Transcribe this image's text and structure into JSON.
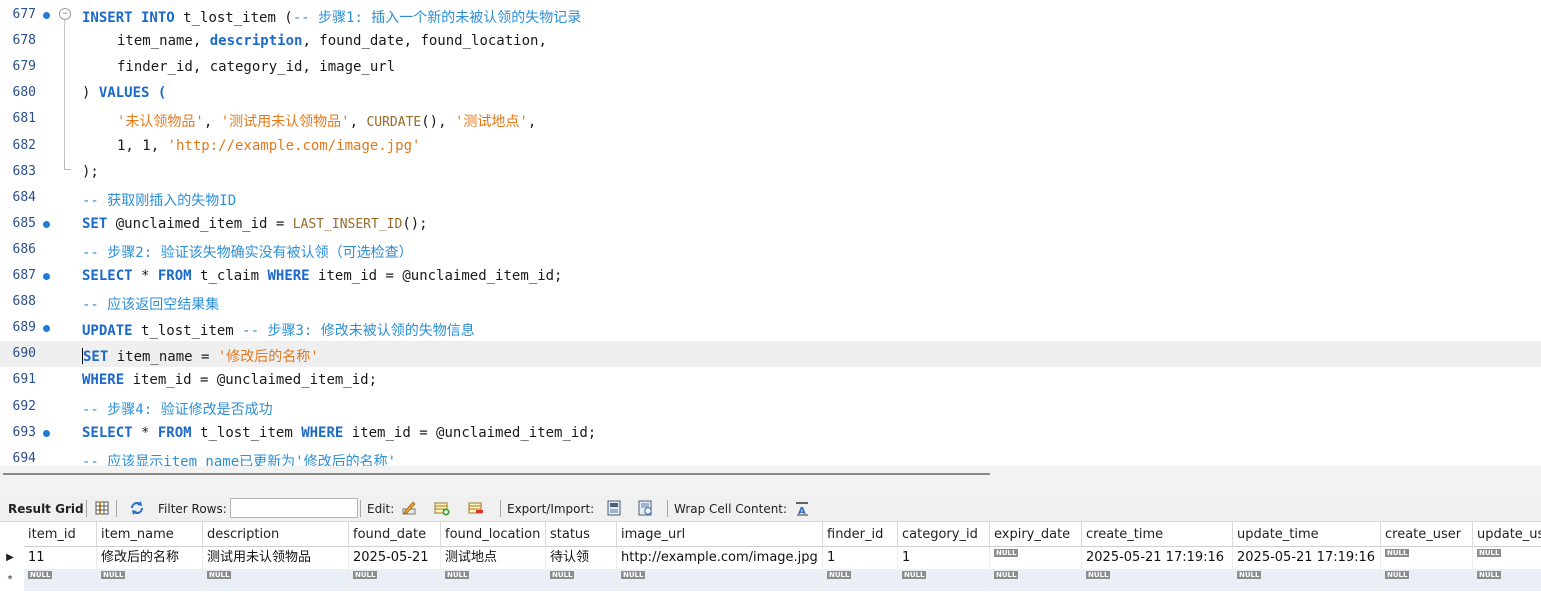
{
  "editor": {
    "lines": [
      {
        "n": "677",
        "dot": true,
        "fold": "start",
        "indent": 0,
        "tokens": [
          [
            "kw",
            "INSERT INTO "
          ],
          [
            "",
            "t_lost_item ("
          ],
          [
            "cm",
            "-- 步骤1: 插入一个新的未被认领的失物记录"
          ]
        ]
      },
      {
        "n": "678",
        "indent": 1,
        "tokens": [
          [
            "",
            "item_name, "
          ],
          [
            "kw",
            "description"
          ],
          [
            "",
            ", found_date, found_location,"
          ]
        ]
      },
      {
        "n": "679",
        "indent": 1,
        "tokens": [
          [
            "",
            "finder_id, category_id, image_url"
          ]
        ]
      },
      {
        "n": "680",
        "indent": 0,
        "tokens": [
          [
            "",
            ") "
          ],
          [
            "kw",
            "VALUES"
          ],
          [
            "kw",
            " ("
          ]
        ]
      },
      {
        "n": "681",
        "indent": 1,
        "tokens": [
          [
            "st",
            "'未认领物品'"
          ],
          [
            "",
            ", "
          ],
          [
            "st",
            "'测试用未认领物品'"
          ],
          [
            "",
            ", "
          ],
          [
            "fn",
            "CURDATE"
          ],
          [
            "",
            "(), "
          ],
          [
            "st",
            "'测试地点'"
          ],
          [
            "",
            ","
          ]
        ]
      },
      {
        "n": "682",
        "indent": 1,
        "tokens": [
          [
            "",
            "1, 1, "
          ],
          [
            "st",
            "'http://example.com/image.jpg'"
          ]
        ]
      },
      {
        "n": "683",
        "fold": "end",
        "indent": 0,
        "tokens": [
          [
            "",
            ");"
          ]
        ]
      },
      {
        "n": "684",
        "indent": 0,
        "tokens": [
          [
            "cm",
            "-- 获取刚插入的失物ID"
          ]
        ]
      },
      {
        "n": "685",
        "dot": true,
        "indent": 0,
        "tokens": [
          [
            "kw",
            "SET "
          ],
          [
            "",
            "@unclaimed_item_id = "
          ],
          [
            "fn",
            "LAST_INSERT_ID"
          ],
          [
            "",
            "();"
          ]
        ]
      },
      {
        "n": "686",
        "indent": 0,
        "tokens": [
          [
            "cm",
            "-- 步骤2: 验证该失物确实没有被认领（可选检查）"
          ]
        ]
      },
      {
        "n": "687",
        "dot": true,
        "indent": 0,
        "tokens": [
          [
            "kw",
            "SELECT "
          ],
          [
            "",
            "* "
          ],
          [
            "kw",
            "FROM "
          ],
          [
            "",
            "t_claim "
          ],
          [
            "kw",
            "WHERE "
          ],
          [
            "",
            "item_id = @unclaimed_item_id;"
          ]
        ]
      },
      {
        "n": "688",
        "indent": 0,
        "tokens": [
          [
            "cm",
            "-- 应该返回空结果集"
          ]
        ]
      },
      {
        "n": "689",
        "dot": true,
        "indent": 0,
        "tokens": [
          [
            "kw",
            "UPDATE "
          ],
          [
            "",
            "t_lost_item "
          ],
          [
            "cm",
            "-- 步骤3: 修改未被认领的失物信息"
          ]
        ]
      },
      {
        "n": "690",
        "current": true,
        "indent": 0,
        "tokens": [
          [
            "caret",
            ""
          ],
          [
            "kw",
            "SET "
          ],
          [
            "",
            "item_name = "
          ],
          [
            "st",
            "'修改后的名称'"
          ]
        ]
      },
      {
        "n": "691",
        "indent": 0,
        "tokens": [
          [
            "kw",
            "WHERE "
          ],
          [
            "",
            "item_id = @unclaimed_item_id;"
          ]
        ]
      },
      {
        "n": "692",
        "indent": 0,
        "tokens": [
          [
            "cm",
            "-- 步骤4: 验证修改是否成功"
          ]
        ]
      },
      {
        "n": "693",
        "dot": true,
        "indent": 0,
        "tokens": [
          [
            "kw",
            "SELECT "
          ],
          [
            "",
            "* "
          ],
          [
            "kw",
            "FROM "
          ],
          [
            "",
            "t_lost_item "
          ],
          [
            "kw",
            "WHERE "
          ],
          [
            "",
            "item_id = @unclaimed_item_id;"
          ]
        ]
      },
      {
        "n": "694",
        "indent": 0,
        "tokens": [
          [
            "cm",
            "-- 应该显示item_name已更新为'修改后的名称'"
          ]
        ]
      }
    ]
  },
  "toolbar": {
    "result_grid": "Result Grid",
    "filter_rows": "Filter Rows:",
    "filter_value": "",
    "edit": "Edit:",
    "export_import": "Export/Import:",
    "wrap_cell": "Wrap Cell Content:"
  },
  "grid": {
    "null_label": "NULL",
    "columns": [
      "item_id",
      "item_name",
      "description",
      "found_date",
      "found_location",
      "status",
      "image_url",
      "finder_id",
      "category_id",
      "expiry_date",
      "create_time",
      "update_time",
      "create_user",
      "update_us"
    ],
    "rows": [
      {
        "marker": "▶",
        "cells": [
          "11",
          "修改后的名称",
          "测试用未认领物品",
          "2025-05-21",
          "测试地点",
          "待认领",
          "http://example.com/image.jpg",
          "1",
          "1",
          null,
          "2025-05-21 17:19:16",
          "2025-05-21 17:19:16",
          null,
          null
        ]
      },
      {
        "marker": "*",
        "cells": [
          null,
          null,
          null,
          null,
          null,
          null,
          null,
          null,
          null,
          null,
          null,
          null,
          null,
          null
        ]
      }
    ]
  }
}
